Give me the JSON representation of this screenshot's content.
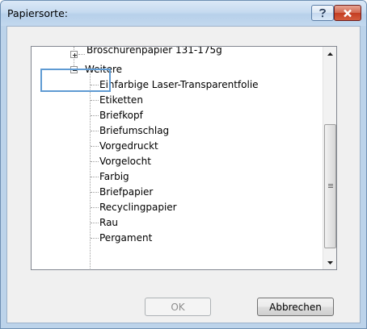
{
  "dialog": {
    "title": "Papiersorte:",
    "help_icon": "question-mark",
    "close_icon": "x"
  },
  "tree": {
    "items": [
      {
        "label": "Broschürenpapier 131-175g",
        "expanded": false,
        "level": 0
      },
      {
        "label": "Weitere",
        "expanded": true,
        "level": 0,
        "selected": true
      },
      {
        "label": "Einfarbige Laser-Transparentfolie",
        "level": 1
      },
      {
        "label": "Etiketten",
        "level": 1
      },
      {
        "label": "Briefkopf",
        "level": 1
      },
      {
        "label": "Briefumschlag",
        "level": 1
      },
      {
        "label": "Vorgedruckt",
        "level": 1
      },
      {
        "label": "Vorgelocht",
        "level": 1
      },
      {
        "label": "Farbig",
        "level": 1
      },
      {
        "label": "Briefpapier",
        "level": 1
      },
      {
        "label": "Recyclingpapier",
        "level": 1
      },
      {
        "label": "Rau",
        "level": 1
      },
      {
        "label": "Pergament",
        "level": 1
      }
    ]
  },
  "buttons": {
    "ok": {
      "label": "OK",
      "enabled": false
    },
    "cancel": {
      "label": "Abbrechen",
      "enabled": true
    }
  }
}
